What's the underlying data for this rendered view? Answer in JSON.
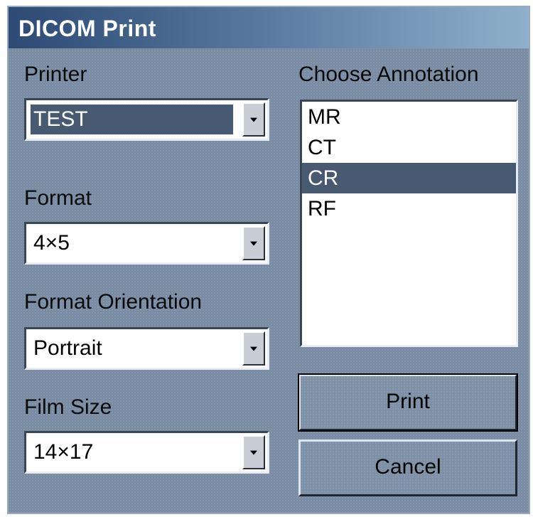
{
  "dialog": {
    "title": "DICOM Print"
  },
  "printer": {
    "label": "Printer",
    "value": "TEST"
  },
  "format": {
    "label": "Format",
    "value": "4×5"
  },
  "orientation": {
    "label": "Format Orientation",
    "value": "Portrait"
  },
  "film_size": {
    "label": "Film Size",
    "value": "14×17"
  },
  "annotation": {
    "label": "Choose Annotation",
    "items": [
      "MR",
      "CT",
      "CR",
      "RF"
    ],
    "selected": "CR"
  },
  "buttons": {
    "print": "Print",
    "cancel": "Cancel"
  },
  "icons": {
    "dropdown": "chevron-down-icon"
  },
  "colors": {
    "titlebar_start": "#2c4a74",
    "titlebar_end": "#8fb0cc",
    "dialog_bg": "#7a8ca3",
    "selection": "#485a72"
  }
}
